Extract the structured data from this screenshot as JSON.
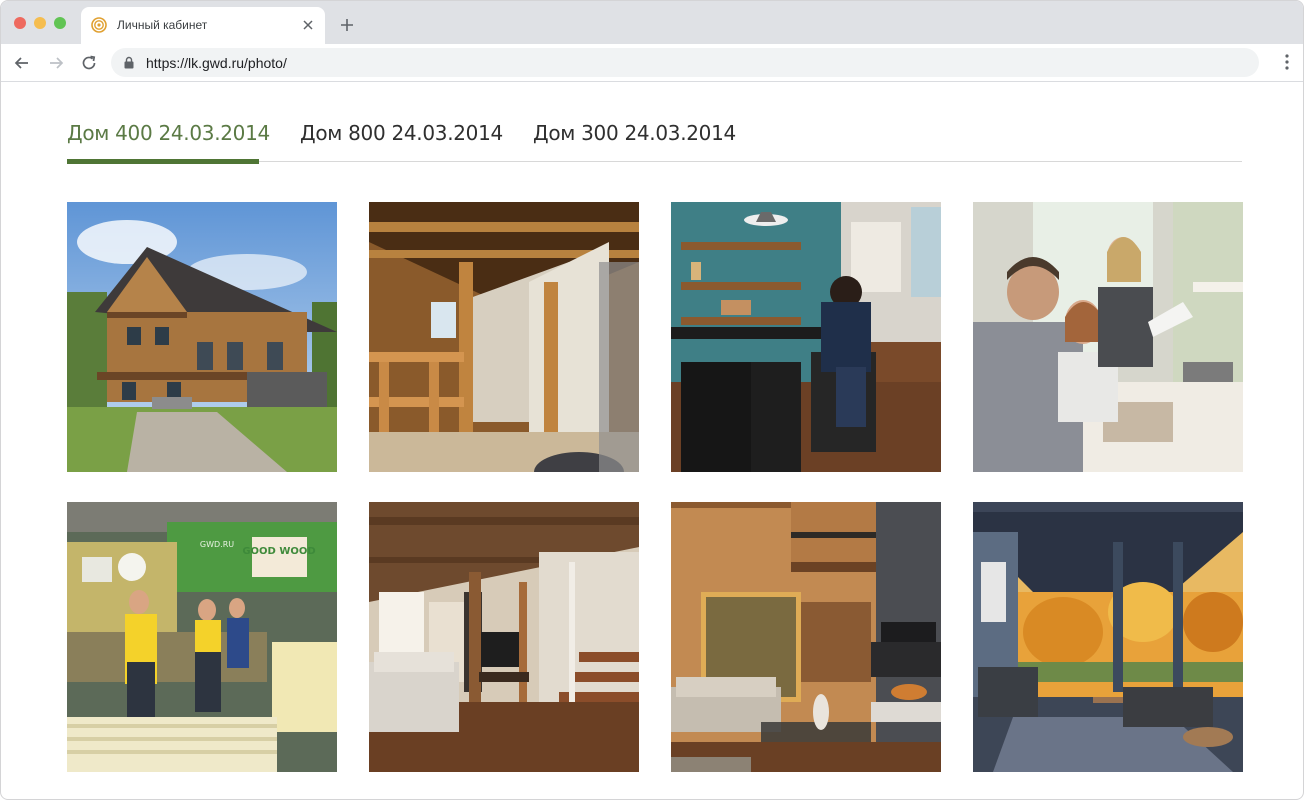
{
  "browser": {
    "tab_title": "Личный кабинет",
    "url": "https://lk.gwd.ru/photo/"
  },
  "gallery": {
    "tabs": [
      {
        "label": "Дом 400 24.03.2014",
        "active": true
      },
      {
        "label": "Дом 800 24.03.2014",
        "active": false
      },
      {
        "label": "Дом 300 24.03.2014",
        "active": false
      }
    ],
    "photos": [
      {
        "subject": "house-exterior"
      },
      {
        "subject": "attic-construction"
      },
      {
        "subject": "kitchen-bar"
      },
      {
        "subject": "team-meeting"
      },
      {
        "subject": "factory-workers",
        "sign_text": "GOOD WOOD",
        "sign_url": "GWD.RU"
      },
      {
        "subject": "living-room-stairs"
      },
      {
        "subject": "living-room-fireplace"
      },
      {
        "subject": "covered-terrace"
      }
    ]
  },
  "colors": {
    "accent": "#4f7535",
    "active_tab_text": "#5b7a45"
  }
}
